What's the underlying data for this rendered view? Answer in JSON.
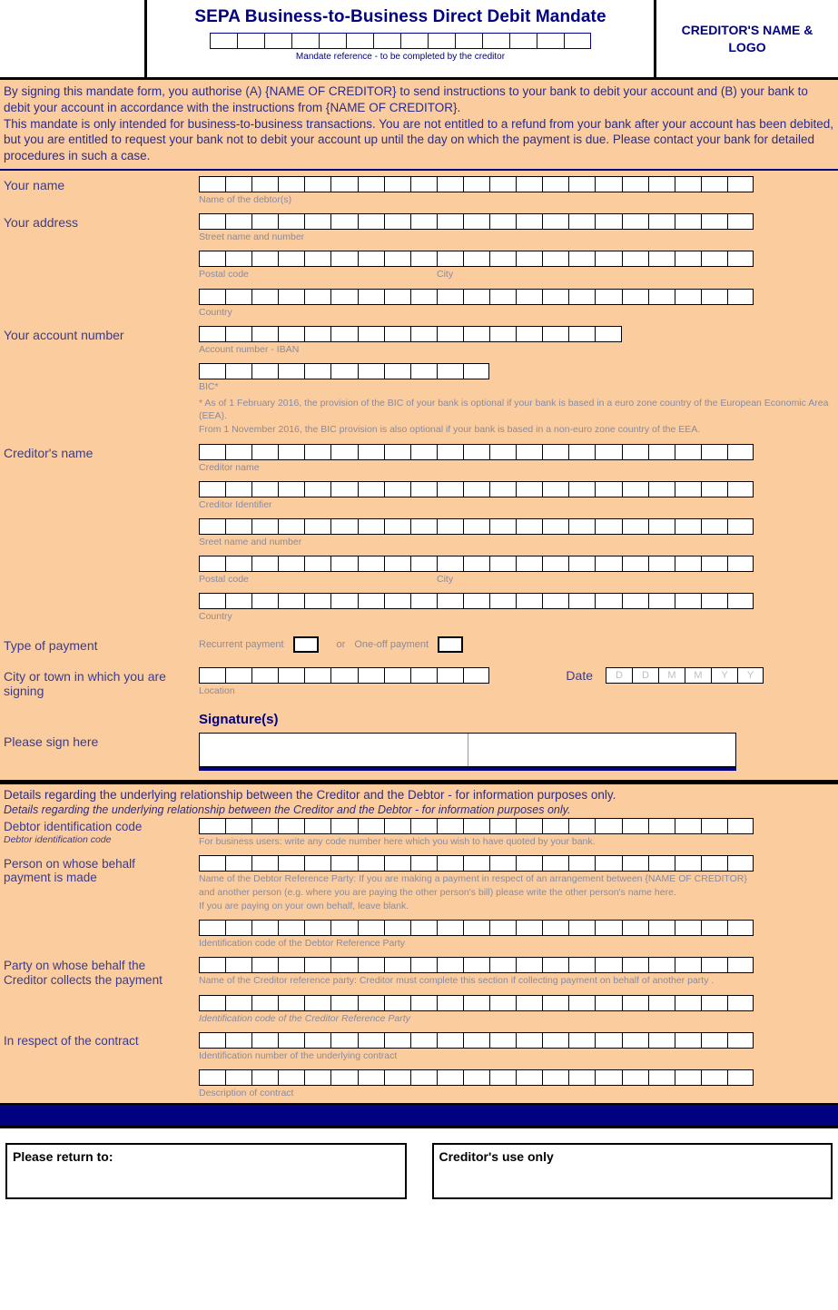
{
  "header": {
    "title": "SEPA Business-to-Business Direct Debit Mandate",
    "mandate_caption": "Mandate reference - to be completed by the creditor",
    "mandate_boxes": 14,
    "creditor_logo_line1": "CREDITOR'S NAME &",
    "creditor_logo_line2": "LOGO",
    "creditor_logo_text": "CREDITOR'S NAME & LOGO"
  },
  "legal": {
    "para1": "By signing this mandate form, you authorise (A) {NAME OF CREDITOR} to send instructions to your bank to debit your account and (B) your bank to debit your account in accordance with the instructions from {NAME OF CREDITOR}.",
    "para2": "This mandate is only intended for business-to-business transactions. You are not entitled to a refund from your bank after your account has been debited, but you are entitled to request your bank not to debit your account up until the day on which the payment is due. Please contact your bank for detailed procedures in such a case."
  },
  "form": {
    "your_name": {
      "label": "Your name",
      "caption": "Name of the debtor(s)",
      "boxes": 21
    },
    "your_address": {
      "label": "Your address",
      "street_caption": "Street name and number",
      "street_boxes": 21,
      "postal_caption": "Postal code",
      "city_caption": "City",
      "postal_boxes": 21,
      "country_caption": "Country",
      "country_boxes": 21
    },
    "your_account": {
      "label": "Your account number",
      "iban_caption": "Account number - IBAN",
      "iban_boxes": 16,
      "bic_caption": "BIC*",
      "bic_boxes": 11,
      "footnote1": "* As of 1 February 2016, the provision of the BIC of your bank is optional if your bank is based in a euro zone country of the European Economic Area (EEA).",
      "footnote2": "From 1 November 2016, the BIC provision is also optional if your bank is based in a non-euro zone country of the EEA."
    },
    "creditor": {
      "label": "Creditor's name",
      "name_caption": "Creditor name",
      "name_boxes": 21,
      "identifier_caption": "Creditor Identifier",
      "identifier_boxes": 21,
      "street_caption": "Sreet name and number",
      "street_boxes": 21,
      "postal_caption": "Postal code",
      "city_caption": "City",
      "postal_boxes": 21,
      "country_caption": "Country",
      "country_boxes": 21
    },
    "payment_type": {
      "label": "Type of payment",
      "recurrent_label": "Recurrent payment",
      "or_label": "or",
      "oneoff_label": "One-off payment"
    },
    "signing": {
      "label_line1": "City or town in which you are",
      "label_line2": "signing",
      "label": "City or town in which you are signing",
      "location_caption": "Location",
      "location_boxes": 11,
      "date_label": "Date",
      "date_placeholders": [
        "D",
        "D",
        "M",
        "M",
        "Y",
        "Y"
      ]
    },
    "signature": {
      "title": "Signature(s)",
      "label": "Please sign here"
    }
  },
  "relationship": {
    "heading": "Details regarding the underlying relationship between the Creditor and the Debtor - for information purposes only.",
    "heading_italic": "Details regarding the underlying relationship between the Creditor and the Debtor - for information purposes only.",
    "debtor_id": {
      "label": "Debtor identification code",
      "sublabel": "Debtor identification code",
      "caption": "For business users: write any code number here which you wish to have quoted by your bank.",
      "boxes": 21
    },
    "person_behalf": {
      "label_line1": "Person on whose behalf",
      "label_line2": "payment is made",
      "label": "Person on whose behalf payment is made",
      "caption_line1": "Name of the Debtor Reference Party: If you are making a payment in respect of an arrangement between {NAME OF CREDITOR}",
      "caption_line2": "and another person (e.g. where you are paying the other person's bill) please write the other person's name here.",
      "caption_line3": "If you are paying on your own behalf, leave blank.",
      "name_boxes": 21,
      "id_caption": "Identification code of the Debtor Reference Party",
      "id_boxes": 21
    },
    "party_behalf": {
      "label_line1": "Party on whose behalf the",
      "label_line2": "Creditor collects the payment",
      "label": "Party on whose behalf the Creditor collects the payment",
      "name_caption": "Name of the Creditor reference party: Creditor must complete this section if collecting payment on behalf of another party .",
      "name_boxes": 21,
      "id_caption": "Identification code of the Creditor Reference Party",
      "id_boxes": 21
    },
    "contract": {
      "label": "In respect of the contract",
      "number_caption": "Identification number of the underlying contract",
      "number_boxes": 21,
      "description_caption": "Description of contract",
      "description_boxes": 21
    }
  },
  "footer": {
    "return_to": "Please return to:",
    "creditor_use": "Creditor's use only"
  },
  "colors": {
    "background": "#FBCD9E",
    "navy": "#000080",
    "label": "#3B3B8F",
    "caption": "#8A8A9E",
    "ink": "#2B2B8C"
  }
}
